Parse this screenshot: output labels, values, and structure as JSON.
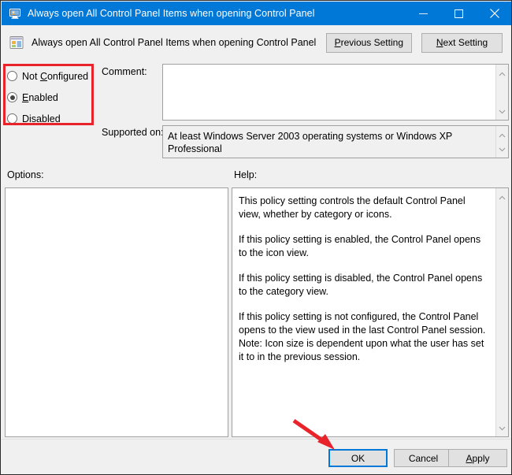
{
  "window": {
    "title": "Always open All Control Panel Items when opening Control Panel",
    "title_icon": "policy-monitor-icon",
    "controls": {
      "minimize": "minimize-icon",
      "maximize": "maximize-icon",
      "close": "close-icon"
    }
  },
  "header": {
    "icon": "policy-setting-icon",
    "policy_title": "Always open All Control Panel Items when opening Control Panel",
    "previous_button": {
      "prefix": "",
      "accel": "P",
      "rest": "revious Setting"
    },
    "next_button": {
      "prefix": "",
      "accel": "N",
      "rest": "ext Setting"
    }
  },
  "state_group": {
    "highlighted": true,
    "highlight_color": "#e8232a",
    "options": [
      {
        "label_prefix": "Not ",
        "accel": "C",
        "label_rest": "onfigured",
        "selected": false
      },
      {
        "label_prefix": "",
        "accel": "E",
        "label_rest": "nabled",
        "selected": true
      },
      {
        "label_prefix": "",
        "accel": "D",
        "label_rest": "isabled",
        "selected": false
      }
    ]
  },
  "comment": {
    "label": "Comment:",
    "value": "",
    "placeholder": ""
  },
  "supported_on": {
    "label": "Supported on:",
    "value": "At least Windows Server 2003 operating systems or Windows XP Professional",
    "readonly": true
  },
  "options_panel": {
    "label": "Options:",
    "content": ""
  },
  "help_panel": {
    "label": "Help:",
    "paragraphs": [
      "This policy setting controls the default Control Panel view, whether by category or icons.",
      "If this policy setting is enabled, the Control Panel opens to the icon view.",
      "If this policy setting is disabled, the Control Panel opens to the category view.",
      "If this policy setting is not configured, the Control Panel opens to the view used in the last Control Panel session.",
      "Note: Icon size is dependent upon what the user has set it to in the previous session."
    ]
  },
  "footer": {
    "ok": {
      "label": "OK",
      "focused": true
    },
    "cancel": {
      "label": "Cancel"
    },
    "apply": {
      "prefix": "",
      "accel": "A",
      "rest": "pply"
    }
  },
  "annotation": {
    "arrow_color": "#e8232a",
    "arrow_points_to": "ok-button"
  },
  "colors": {
    "titlebar": "#0078d7",
    "dialog_bg": "#f0f0f0",
    "focus_border": "#0078d7",
    "annotation_red": "#e8232a"
  }
}
